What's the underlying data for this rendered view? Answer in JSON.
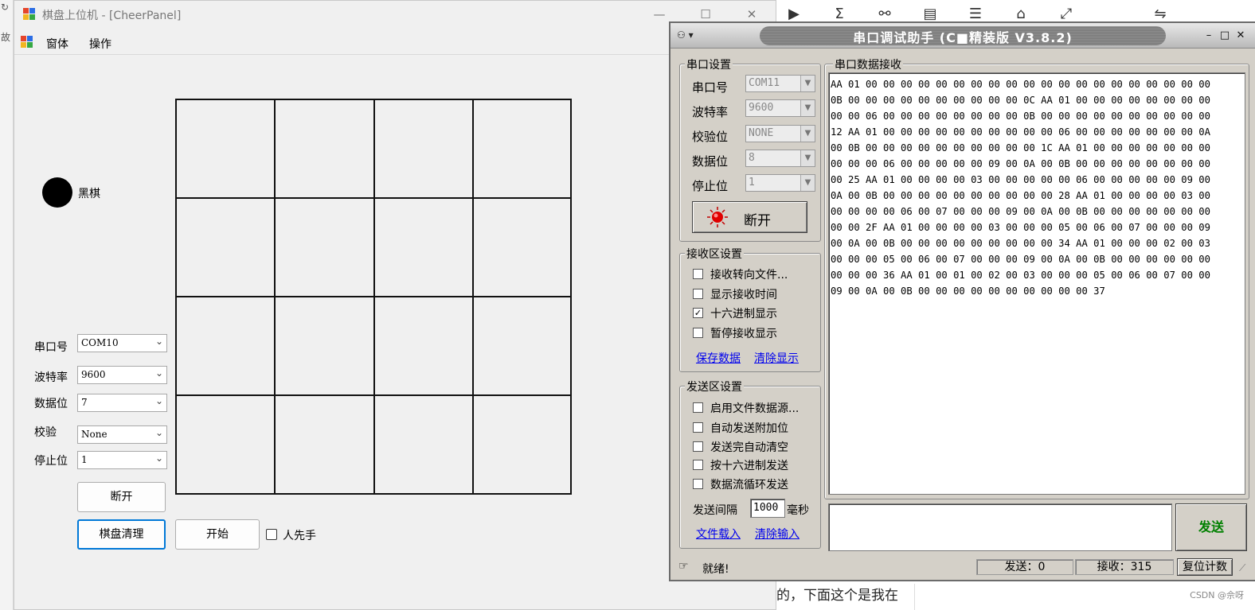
{
  "background": {
    "left_strip_chars": [
      "故"
    ],
    "bg_text": "的，下面这个是我在",
    "watermark": "CSDN @佘呀",
    "toolbar_icons": [
      "video-icon",
      "sigma-icon",
      "link-icon",
      "layout-icon",
      "list-icon",
      "stamp-icon",
      "expand-icon",
      "swap-icon"
    ]
  },
  "app": {
    "title": "棋盘上位机 - [CheerPanel]",
    "menu": [
      "窗体",
      "操作"
    ],
    "piece_label": "黑棋",
    "serial": {
      "port_label": "串口号",
      "port_value": "COM10",
      "baud_label": "波特率",
      "baud_value": "9600",
      "databits_label": "数据位",
      "databits_value": "7",
      "parity_label": "校验",
      "parity_value": "None",
      "stopbits_label": "停止位",
      "stopbits_value": "1"
    },
    "disconnect_label": "断开",
    "clear_label": "棋盘清理",
    "start_label": "开始",
    "human_first_label": "人先手",
    "human_first_checked": false,
    "board_rows": 4,
    "board_cols": 4
  },
  "assistant": {
    "title": "串口调试助手 (C■精装版 V3.8.2)",
    "serial_group_title": "串口设置",
    "port_label": "串口号",
    "port_value": "COM11",
    "baud_label": "波特率",
    "baud_value": "9600",
    "parity_label": "校验位",
    "parity_value": "NONE",
    "databits_label": "数据位",
    "databits_value": "8",
    "stopbits_label": "停止位",
    "stopbits_value": "1",
    "open_button_label": "断开",
    "status_led_color": "#e00000",
    "recv_group_title": "接收区设置",
    "recv_options": [
      {
        "label": "接收转向文件...",
        "checked": false
      },
      {
        "label": "显示接收时间",
        "checked": false
      },
      {
        "label": "十六进制显示",
        "checked": true
      },
      {
        "label": "暂停接收显示",
        "checked": false
      }
    ],
    "save_data_link": "保存数据",
    "clear_display_link": "清除显示",
    "send_group_title": "发送区设置",
    "send_options": [
      {
        "label": "启用文件数据源...",
        "checked": false
      },
      {
        "label": "自动发送附加位",
        "checked": false
      },
      {
        "label": "发送完自动清空",
        "checked": false
      },
      {
        "label": "按十六进制发送",
        "checked": false
      },
      {
        "label": "数据流循环发送",
        "checked": false
      }
    ],
    "interval_label": "发送间隔",
    "interval_value": "1000",
    "interval_unit": "毫秒",
    "load_file_link": "文件载入",
    "clear_input_link": "清除输入",
    "recv_area_title": "串口数据接收",
    "recv_lines": [
      "AA 01 00 00 00 00 00 00 00 00 00 00 00 00 00 00 00 00 00 00 00 00",
      "0B 00 00 00 00 00 00 00 00 00 00 0C AA 01 00 00 00 00 00 00 00 00",
      "00 00 06 00 00 00 00 00 00 00 00 0B 00 00 00 00 00 00 00 00 00 00",
      "12 AA 01 00 00 00 00 00 00 00 00 00 00 06 00 00 00 00 00 00 00 0A",
      "00 0B 00 00 00 00 00 00 00 00 00 00 1C AA 01 00 00 00 00 00 00 00",
      "00 00 00 06 00 00 00 00 00 09 00 0A 00 0B 00 00 00 00 00 00 00 00",
      "00 25 AA 01 00 00 00 00 03 00 00 00 00 00 06 00 00 00 00 00 09 00",
      "0A 00 0B 00 00 00 00 00 00 00 00 00 00 28 AA 01 00 00 00 00 03 00",
      "00 00 00 00 06 00 07 00 00 00 09 00 0A 00 0B 00 00 00 00 00 00 00",
      "00 00 2F AA 01 00 00 00 00 03 00 00 00 05 00 06 00 07 00 00 00 09",
      "00 0A 00 0B 00 00 00 00 00 00 00 00 00 34 AA 01 00 00 00 02 00 03",
      "00 00 00 05 00 06 00 07 00 00 00 09 00 0A 00 0B 00 00 00 00 00 00",
      "00 00 00 36 AA 01 00 01 00 02 00 03 00 00 00 05 00 06 00 07 00 00",
      "09 00 0A 00 0B 00 00 00 00 00 00 00 00 00 00 37"
    ],
    "send_button_label": "发送",
    "send_button_color": "#008000",
    "status_text": "就绪!",
    "sent_label": "发送：0",
    "received_label": "接收：315",
    "reset_count_label": "复位计数"
  }
}
